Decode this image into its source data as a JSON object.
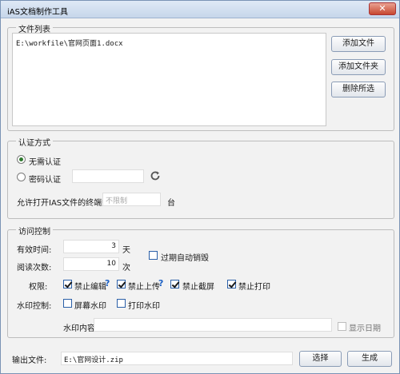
{
  "window": {
    "title": "iAS文档制作工具",
    "close_glyph": "✕"
  },
  "file_list": {
    "legend": "文件列表",
    "items": [
      "E:\\workfile\\官网页面1.docx"
    ],
    "add_file": "添加文件",
    "add_folder": "添加文件夹",
    "delete_selected": "删除所选"
  },
  "auth": {
    "legend": "认证方式",
    "no_auth": "无需认证",
    "no_auth_selected": true,
    "password_auth": "密码认证",
    "password_value": "",
    "refresh_icon": "refresh-icon",
    "terminals_label": "允许打开IAS文件的终端数:",
    "terminals_placeholder": "不限制",
    "terminals_unit": "台"
  },
  "access": {
    "legend": "访问控制",
    "validity_label": "有效时间:",
    "validity_value": "3",
    "validity_unit": "天",
    "reads_label": "阅读次数:",
    "reads_value": "10",
    "reads_unit": "次",
    "auto_destroy": "过期自动销毁",
    "auto_destroy_checked": false,
    "perm_label": "权限:",
    "perms": [
      {
        "label": "禁止编辑",
        "checked": true,
        "help": "?"
      },
      {
        "label": "禁止上传",
        "checked": true,
        "help": "?"
      },
      {
        "label": "禁止截屏",
        "checked": true
      },
      {
        "label": "禁止打印",
        "checked": true
      }
    ],
    "watermark_label": "水印控制:",
    "screen_watermark": "屏幕水印",
    "print_watermark": "打印水印",
    "watermark_content_label": "水印内容",
    "watermark_content": "",
    "show_date": "显示日期"
  },
  "output": {
    "label": "输出文件:",
    "value": "E:\\官网设计.zip",
    "browse": "选择",
    "generate": "生成"
  },
  "colors": {
    "accent": "#1f62c4",
    "titlebar": "#c6d6ea",
    "close": "#c7472f"
  }
}
